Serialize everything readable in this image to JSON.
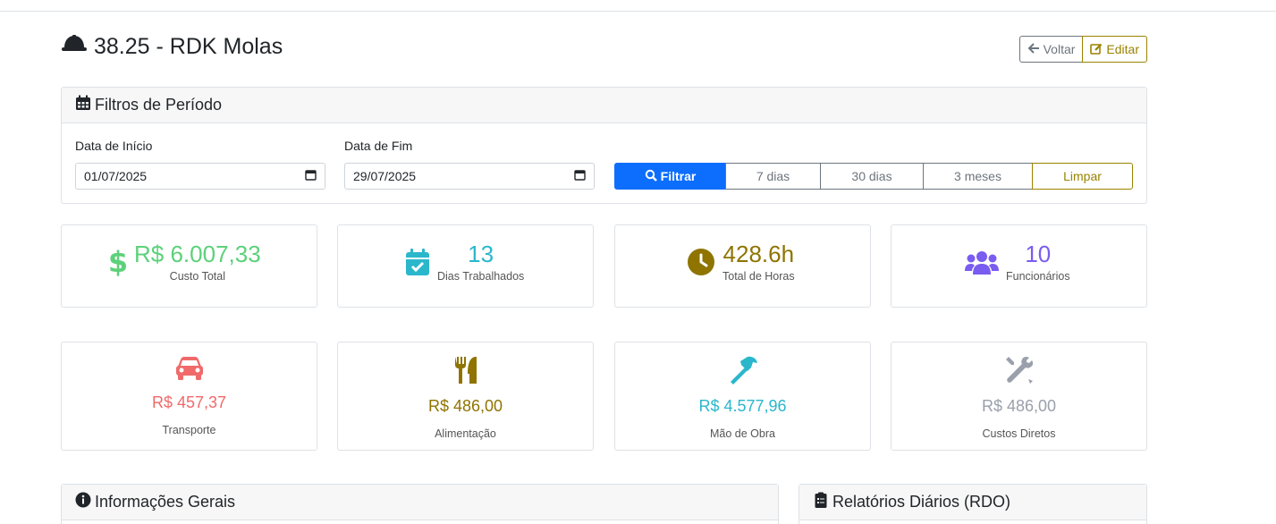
{
  "header": {
    "title": "38.25 - RDK Molas",
    "back_label": "Voltar",
    "edit_label": "Editar"
  },
  "filters": {
    "title": "Filtros de Período",
    "start_label": "Data de Início",
    "start_value": "01/07/2025",
    "end_label": "Data de Fim",
    "end_value": "29/07/2025",
    "buttons": {
      "filter": "Filtrar",
      "d7": "7 dias",
      "d30": "30 dias",
      "m3": "3 meses",
      "clear": "Limpar"
    }
  },
  "stats": [
    {
      "value": "R$ 6.007,33",
      "label": "Custo Total",
      "icon": "dollar-icon",
      "color": "#5cd17a"
    },
    {
      "value": "13",
      "label": "Dias Trabalhados",
      "icon": "calendar-check-icon",
      "color": "#2ab7cc"
    },
    {
      "value": "428.6h",
      "label": "Total de Horas",
      "icon": "clock-icon",
      "color": "#8f7400"
    },
    {
      "value": "10",
      "label": "Funcionários",
      "icon": "users-icon",
      "color": "#7a5cf0"
    }
  ],
  "costs": [
    {
      "value": "R$ 457,37",
      "label": "Transporte",
      "icon": "car-icon",
      "color": "#f06a6a"
    },
    {
      "value": "R$ 486,00",
      "label": "Alimentação",
      "icon": "utensils-icon",
      "color": "#8f7400"
    },
    {
      "value": "R$ 4.577,96",
      "label": "Mão de Obra",
      "icon": "hammer-icon",
      "color": "#2ab7cc"
    },
    {
      "value": "R$ 486,00",
      "label": "Custos Diretos",
      "icon": "tools-icon",
      "color": "#9aa0ab"
    }
  ],
  "sections": {
    "info_title": "Informações Gerais",
    "rdo_title": "Relatórios Diários (RDO)"
  }
}
